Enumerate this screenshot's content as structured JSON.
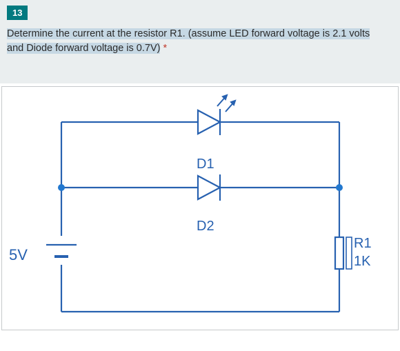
{
  "question_number": "13",
  "prompt_line1": "Determine the current at the resistor R1. (assume LED forward voltage is 2.1 volts",
  "prompt_line2": "and Diode forward voltage is 0.7V)",
  "required_mark": "*",
  "circuit": {
    "source_label": "5V",
    "d1_label": "D1",
    "d2_label": "D2",
    "r_label": "R1",
    "r_value": "1K"
  }
}
